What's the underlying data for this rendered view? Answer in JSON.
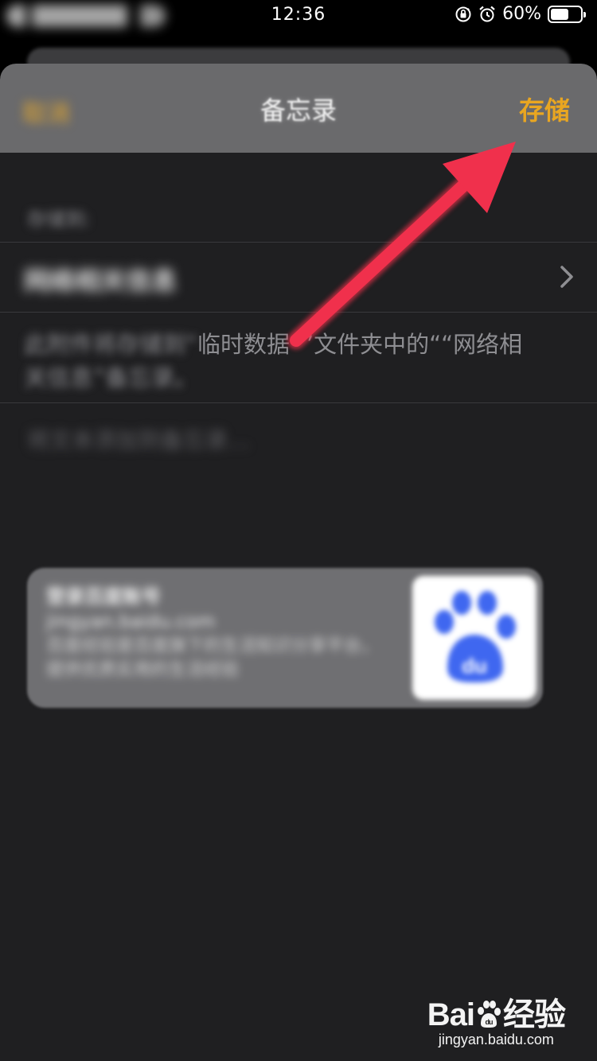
{
  "status_bar": {
    "time": "12:36",
    "battery_text": "60%",
    "battery_level": 0.6,
    "icons": [
      "orientation-lock-icon",
      "alarm-icon",
      "battery-icon"
    ]
  },
  "navbar": {
    "cancel_label": "取消",
    "title": "备忘录",
    "save_label": "存储",
    "accent_color": "#e9a621"
  },
  "content": {
    "section_label": "存储到:",
    "folder_row_label": "网络相关信息",
    "description_blurred": "此附件将存储到“",
    "description_clear_mid": "临时数据",
    "description_clear": "””文件夹中的““网络相",
    "description_line2": "关信息”备忘录。",
    "placeholder": "将文本添加到备忘录…"
  },
  "link_card": {
    "title": "登录百度账号",
    "url": "jingyan.baidu.com",
    "description": "百度经验是百度旗下的生活知识分享平台，提供优质实用的生活经验"
  },
  "watermark": {
    "brand": "Bai",
    "brand_suffix": "经验",
    "url": "jingyan.baidu.com"
  },
  "annotation": {
    "arrow_color": "#f0304c"
  }
}
